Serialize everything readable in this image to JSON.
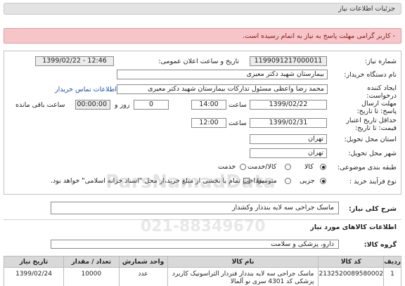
{
  "header": {
    "title": "جزئیات اطلاعات نیاز"
  },
  "alert": {
    "text": "- کاربر گرامی مهلت پاسخ به نیاز به اتمام رسیده است."
  },
  "form": {
    "need_number_label": "شماره نیاز:",
    "need_number": "1199091217000011",
    "announce_label": "تاریخ و ساعت اعلان عمومی:",
    "announce_value": "1399/02/22 - 12:46",
    "buyer_label": "نام دستگاه خریدار:",
    "buyer_value": "بیمارستان شهید دکتر معیری",
    "creator_label": "ایجاد کننده درخواست:",
    "creator_value": "محمد رضا  واعظی  مسئول تدارکات بیمارستان شهید دکتر معیری",
    "contact_link": "اطلاعات تماس خریدار",
    "deadline_label": "مهلت ارسال پاسخ: تا تاریخ:",
    "deadline_date": "1399/02/22",
    "time_label": "ساعت",
    "deadline_time": "14:00",
    "days_value": "0",
    "days_label": "روز و",
    "remaining_time": "00:00:00",
    "remaining_label": "ساعت باقی مانده",
    "validity_label": "حداقل تاریخ اعتبار قیمت: تا تاریخ:",
    "validity_date": "1399/02/31",
    "validity_time": "12:00",
    "province_label": "استان محل تحویل:",
    "province_value": "تهران",
    "city_label": "شهر محل تحویل:",
    "city_value": "تهران",
    "category_label": "طبقه بندی موضوعی:",
    "category_options": [
      "کالا",
      "کالا/خدمت",
      "خدمت"
    ],
    "process_label": "نوع فرآیند خرید :",
    "process_options": [
      "جزیی",
      "متوسط"
    ],
    "payment_note": "پرداخت تمام یا بخشی از مبلغ خرید،از محل \"اسناد خزانه اسلامی\" خواهد بود."
  },
  "description": {
    "title": "شرح کلی نیاز:",
    "text": "ماسک جراحی سه لایه بنددار  وکشدار"
  },
  "goods_section": {
    "title": "اطلاعات کالاهای مورد نیاز"
  },
  "group": {
    "label": "گروه کالا:",
    "value": "دارو، پزشکی و سلامت"
  },
  "table": {
    "headers": [
      "ردیف",
      "کد کالا",
      "نام کالا",
      "واحد شمارش",
      "تعداد / مقدار",
      "تاریخ نیاز"
    ],
    "row": {
      "index": "1",
      "code": "2132520089580002",
      "name_line1": "ماسک جراحی سه لایه بنددار فنردار التراسونیک کاربرد",
      "name_line2": "پزشکی کد 4301 سری نو آلمالا",
      "unit": "عدد",
      "qty": "10000",
      "date": "1399/02/24"
    }
  },
  "watermark": {
    "line1": "ParsNamadData",
    "line2": "021-88349670"
  }
}
